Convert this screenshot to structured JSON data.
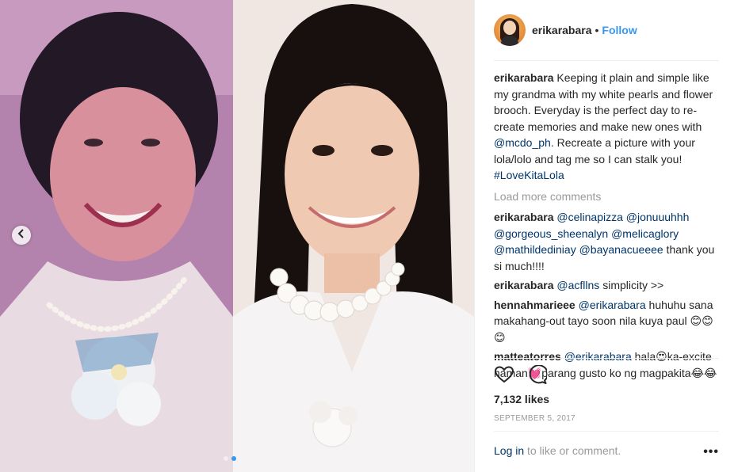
{
  "post": {
    "username": "erikarabara",
    "follow_label": "Follow",
    "separator": "•",
    "caption": {
      "user": "erikarabara",
      "text": "Keeping it plain and simple like my grandma with my white pearls and flower brooch. Everyday is the perfect day to re-create memories and make new ones with ",
      "mention": "@mcdo_ph",
      "text2": ". Recreate a picture with your lola/lolo and tag me so I can stalk you! ",
      "hashtag": "#LoveKitaLola"
    },
    "load_more": "Load more comments",
    "comments": [
      {
        "user": "erikarabara",
        "mentions": "@celinapizza @jonuuuhhh @gorgeous_sheenalyn @melicaglory @mathildediniay @bayanacueeee",
        "text": " thank you si much!!!!"
      },
      {
        "user": "erikarabara",
        "mentions": "@acfllns",
        "text": " simplicity >>"
      },
      {
        "user": "hennahmarieee",
        "mentions": "@erikarabara",
        "text": " huhuhu sana makahang-out tayo soon nila kuya paul 😊😊😊"
      },
      {
        "user": "matteatorres",
        "mentions": "@erikarabara",
        "text": " hala😍ka-excite naman💓parang gusto ko ng magpakita😂😂"
      }
    ],
    "likes": "7,132 likes",
    "date": "SEPTEMBER 5, 2017",
    "login_link": "Log in",
    "login_text": " to like or comment.",
    "more_label": "•••",
    "carousel": {
      "current": 1,
      "total": 2
    }
  },
  "icons": {
    "like": "heart-icon",
    "comment": "comment-bubble-icon",
    "prev": "chevron-left-icon",
    "more": "more-options-icon"
  },
  "colors": {
    "link_blue": "#3897f0",
    "mention": "#003569",
    "muted": "#999999",
    "text": "#262626"
  }
}
